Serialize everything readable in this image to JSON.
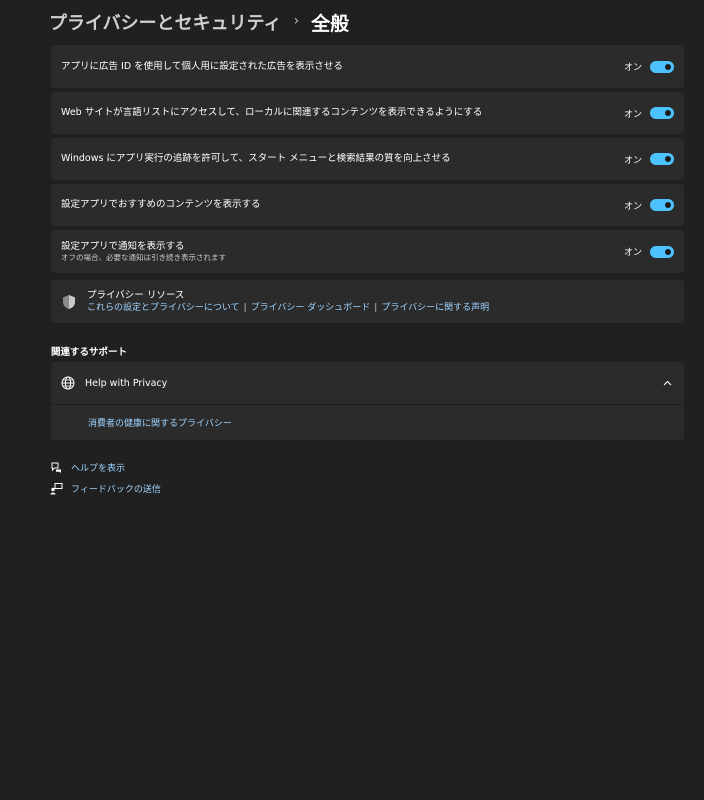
{
  "breadcrumb": {
    "parent": "プライバシーとセキュリティ",
    "separator": "›",
    "current": "全般"
  },
  "settings": [
    {
      "label": "アプリに広告 ID を使用して個人用に設定された広告を表示させる",
      "state_label": "オン",
      "on": true
    },
    {
      "label": "Web サイトが言語リストにアクセスして、ローカルに関連するコンテンツを表示できるようにする",
      "state_label": "オン",
      "on": true
    },
    {
      "label": "Windows にアプリ実行の追跡を許可して、スタート メニューと検索結果の質を向上させる",
      "state_label": "オン",
      "on": true
    },
    {
      "label": "設定アプリでおすすめのコンテンツを表示する",
      "state_label": "オン",
      "on": true
    },
    {
      "label": "設定アプリで通知を表示する",
      "sublabel": "オフの場合、必要な通知は引き続き表示されます",
      "state_label": "オン",
      "on": true
    }
  ],
  "privacy_resources": {
    "icon": "shield-icon",
    "title": "プライバシー リソース",
    "links": [
      "これらの設定とプライバシーについて",
      "プライバシー ダッシュボード",
      "プライバシーに関する声明"
    ],
    "separator": "|"
  },
  "related_support": {
    "title": "関連するサポート",
    "help": {
      "icon": "globe-icon",
      "title": "Help with Privacy",
      "expanded": true,
      "link": "消費者の健康に関するプライバシー"
    }
  },
  "footer": {
    "help_label": "ヘルプを表示",
    "feedback_label": "フィードバックの送信"
  },
  "colors": {
    "background": "#202020",
    "card": "#2b2b2b",
    "accent": "#4cc2ff",
    "link": "#9dd3ff"
  }
}
